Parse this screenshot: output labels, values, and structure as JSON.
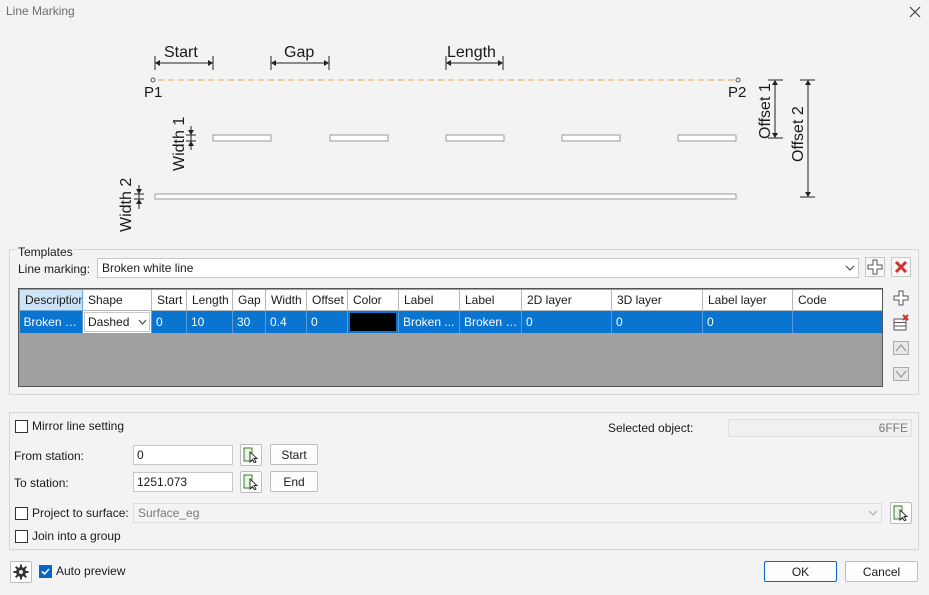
{
  "window": {
    "title": "Line Marking"
  },
  "diagram": {
    "start": "Start",
    "gap": "Gap",
    "length": "Length",
    "p1": "P1",
    "p2": "P2",
    "width1": "Width 1",
    "width2": "Width 2",
    "offset1": "Offset 1",
    "offset2": "Offset 2"
  },
  "templates": {
    "group_label": "Templates",
    "line_marking_label": "Line marking:",
    "line_marking_value": "Broken white line",
    "columns": [
      "Description",
      "Shape",
      "Start",
      "Length",
      "Gap",
      "Width",
      "Offset",
      "Color",
      "Label",
      "Label",
      "2D layer",
      "3D layer",
      "Label layer",
      "Code"
    ],
    "row": {
      "description": "Broken w...",
      "shape": "Dashed",
      "start": "0",
      "length": "10",
      "gap": "30",
      "width": "0.4",
      "offset": "0",
      "color": "#000000",
      "label1": "Broken ...",
      "label2": "Broken w...",
      "layer2d": "0",
      "layer3d": "0",
      "label_layer": "0",
      "code": ""
    }
  },
  "options": {
    "mirror_label": "Mirror line setting",
    "mirror_checked": false,
    "selected_object_label": "Selected object:",
    "selected_object_value": "6FFE",
    "from_station_label": "From station:",
    "from_station_value": "0",
    "start_button": "Start",
    "to_station_label": "To station:",
    "to_station_value": "1251.073",
    "end_button": "End",
    "project_label": "Project to surface:",
    "project_checked": false,
    "surface_value": "Surface_eg",
    "join_label": "Join into a group",
    "join_checked": false
  },
  "footer": {
    "auto_preview_label": "Auto preview",
    "auto_preview_checked": true,
    "ok_label": "OK",
    "cancel_label": "Cancel"
  },
  "colors": {
    "accent": "#0a74d1",
    "delete_red": "#d0312d",
    "dashed_orange": "#f0b060"
  }
}
